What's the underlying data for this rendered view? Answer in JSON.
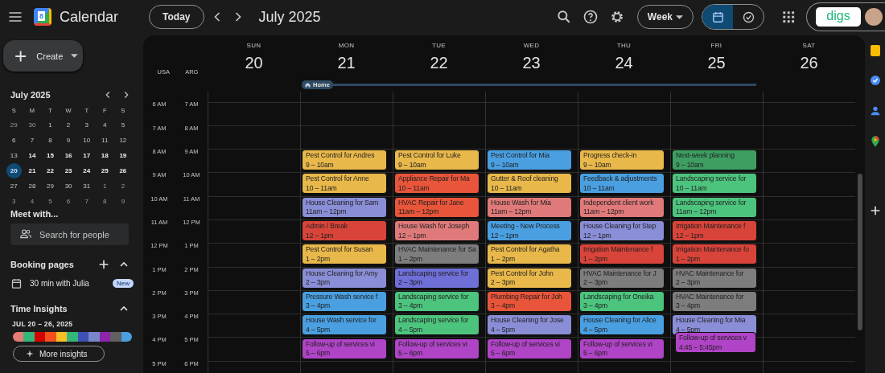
{
  "app": {
    "title": "Calendar",
    "logo_day": "8"
  },
  "toolbar": {
    "today": "Today",
    "period": "July 2025",
    "view": "Week",
    "account_logo": "digs",
    "view_toggle": [
      {
        "kind": "calendar",
        "selected": true
      },
      {
        "kind": "tasks",
        "selected": false
      }
    ]
  },
  "sidebar": {
    "create": "Create",
    "mini_calendar": {
      "title": "July 2025",
      "weekdays": [
        "S",
        "M",
        "T",
        "W",
        "T",
        "F",
        "S"
      ],
      "days": [
        {
          "label": "29",
          "muted": true,
          "bold": false,
          "selected": false
        },
        {
          "label": "30",
          "muted": true,
          "bold": false,
          "selected": false
        },
        {
          "label": "1",
          "muted": false,
          "bold": false,
          "selected": false
        },
        {
          "label": "2",
          "muted": false,
          "bold": false,
          "selected": false
        },
        {
          "label": "3",
          "muted": false,
          "bold": false,
          "selected": false
        },
        {
          "label": "4",
          "muted": false,
          "bold": false,
          "selected": false
        },
        {
          "label": "5",
          "muted": false,
          "bold": false,
          "selected": false
        },
        {
          "label": "6",
          "muted": false,
          "bold": false,
          "selected": false
        },
        {
          "label": "7",
          "muted": false,
          "bold": false,
          "selected": false
        },
        {
          "label": "8",
          "muted": false,
          "bold": false,
          "selected": false
        },
        {
          "label": "9",
          "muted": false,
          "bold": false,
          "selected": false
        },
        {
          "label": "10",
          "muted": false,
          "bold": false,
          "selected": false
        },
        {
          "label": "11",
          "muted": false,
          "bold": false,
          "selected": false
        },
        {
          "label": "12",
          "muted": false,
          "bold": false,
          "selected": false
        },
        {
          "label": "13",
          "muted": false,
          "bold": false,
          "selected": false
        },
        {
          "label": "14",
          "muted": false,
          "bold": true,
          "selected": false
        },
        {
          "label": "15",
          "muted": false,
          "bold": true,
          "selected": false
        },
        {
          "label": "16",
          "muted": false,
          "bold": true,
          "selected": false
        },
        {
          "label": "17",
          "muted": false,
          "bold": true,
          "selected": false
        },
        {
          "label": "18",
          "muted": false,
          "bold": true,
          "selected": false
        },
        {
          "label": "19",
          "muted": false,
          "bold": true,
          "selected": false
        },
        {
          "label": "20",
          "muted": false,
          "bold": true,
          "selected": true
        },
        {
          "label": "21",
          "muted": false,
          "bold": true,
          "selected": false
        },
        {
          "label": "22",
          "muted": false,
          "bold": true,
          "selected": false
        },
        {
          "label": "23",
          "muted": false,
          "bold": true,
          "selected": false
        },
        {
          "label": "24",
          "muted": false,
          "bold": true,
          "selected": false
        },
        {
          "label": "25",
          "muted": false,
          "bold": true,
          "selected": false
        },
        {
          "label": "26",
          "muted": false,
          "bold": true,
          "selected": false
        },
        {
          "label": "27",
          "muted": false,
          "bold": false,
          "selected": false
        },
        {
          "label": "28",
          "muted": false,
          "bold": false,
          "selected": false
        },
        {
          "label": "29",
          "muted": false,
          "bold": false,
          "selected": false
        },
        {
          "label": "30",
          "muted": false,
          "bold": false,
          "selected": false
        },
        {
          "label": "31",
          "muted": false,
          "bold": false,
          "selected": false
        },
        {
          "label": "1",
          "muted": true,
          "bold": false,
          "selected": false
        },
        {
          "label": "2",
          "muted": true,
          "bold": false,
          "selected": false
        },
        {
          "label": "3",
          "muted": true,
          "bold": false,
          "selected": false
        },
        {
          "label": "4",
          "muted": true,
          "bold": false,
          "selected": false
        },
        {
          "label": "5",
          "muted": true,
          "bold": false,
          "selected": false
        },
        {
          "label": "6",
          "muted": true,
          "bold": false,
          "selected": false
        },
        {
          "label": "7",
          "muted": true,
          "bold": false,
          "selected": false
        },
        {
          "label": "8",
          "muted": true,
          "bold": false,
          "selected": false
        },
        {
          "label": "9",
          "muted": true,
          "bold": false,
          "selected": false
        }
      ]
    },
    "meet_with": {
      "heading": "Meet with...",
      "placeholder": "Search for people"
    },
    "booking_pages": {
      "heading": "Booking pages",
      "expanded": true,
      "items": [
        {
          "label": "30 min with Julia",
          "badge": "New"
        }
      ]
    },
    "time_insights": {
      "heading": "Time Insights",
      "expanded": true,
      "range": "JUL 20 – 26, 2025",
      "button": "More insights",
      "segments": [
        {
          "color": "#e67c73"
        },
        {
          "color": "#33b679"
        },
        {
          "color": "#d50000"
        },
        {
          "color": "#f4511e"
        },
        {
          "color": "#f6bf26"
        },
        {
          "color": "#33b679"
        },
        {
          "color": "#3f51b5"
        },
        {
          "color": "#7986cb"
        },
        {
          "color": "#8e24aa"
        },
        {
          "color": "#616161"
        },
        {
          "color": "#4a9fe0"
        }
      ]
    }
  },
  "week": {
    "timezones": [
      "USA",
      "ARG"
    ],
    "hours_primary": [
      "6 AM",
      "7 AM",
      "8 AM",
      "9 AM",
      "10 AM",
      "11 AM",
      "12 PM",
      "1 PM",
      "2 PM",
      "3 PM",
      "4 PM",
      "5 PM"
    ],
    "hours_secondary": [
      "7 AM",
      "8 AM",
      "9 AM",
      "10 AM",
      "11 AM",
      "12 PM",
      "1 PM",
      "2 PM",
      "3 PM",
      "4 PM",
      "5 PM",
      "6 PM"
    ],
    "working_location": {
      "label": "Home"
    },
    "days": [
      {
        "name": "SUN",
        "number": "20"
      },
      {
        "name": "MON",
        "number": "21",
        "home": true,
        "events": [
          {
            "title": "Pest Control for Andres",
            "time": "9 – 10am",
            "color": "#e8b84a"
          },
          {
            "title": "Pest Control for Anne",
            "time": "10 – 11am",
            "color": "#e8b84a"
          },
          {
            "title": "House Cleaning for Sam",
            "time": "11am – 12pm",
            "color": "#8a8ed6"
          },
          {
            "title": "Admin / Break",
            "time": "12 – 1pm",
            "color": "#d9443a"
          },
          {
            "title": "Pest Control for Susan",
            "time": "1 – 2pm",
            "color": "#e8b84a"
          },
          {
            "title": "House Cleaning for Amy",
            "time": "2 – 3pm",
            "color": "#8a8ed6"
          },
          {
            "title": "Pressure Wash service f",
            "time": "3 – 4pm",
            "color": "#4a9fe0"
          },
          {
            "title": "House Wash service for",
            "time": "4 – 5pm",
            "color": "#4a9fe0"
          },
          {
            "title": "Follow-up of services vi",
            "time": "5 – 6pm",
            "color": "#b044c6"
          }
        ]
      },
      {
        "name": "TUE",
        "number": "22",
        "home": true,
        "events": [
          {
            "title": "Pest Control for Luke",
            "time": "9 – 10am",
            "color": "#e8b84a"
          },
          {
            "title": "Appliance Repair for Ma",
            "time": "10 – 11am",
            "color": "#e8553a"
          },
          {
            "title": "HVAC Repair for Jane",
            "time": "11am – 12pm",
            "color": "#e8553a"
          },
          {
            "title": "House Wash for Joseph",
            "time": "12 – 1pm",
            "color": "#e07a7a"
          },
          {
            "title": "HVAC Maintenance for Sa",
            "time": "1 – 2pm",
            "color": "#7d7d7d"
          },
          {
            "title": "Landscaping service for",
            "time": "2 – 3pm",
            "color": "#6f6fd8"
          },
          {
            "title": "Landscaping service for",
            "time": "3 – 4pm",
            "color": "#4dc47e"
          },
          {
            "title": "Landscaping service for",
            "time": "4 – 5pm",
            "color": "#4dc47e"
          },
          {
            "title": "Follow-up of services vi",
            "time": "5 – 6pm",
            "color": "#b044c6"
          }
        ]
      },
      {
        "name": "WED",
        "number": "23",
        "home": true,
        "events": [
          {
            "title": "Pest Control for Mia",
            "time": "9 – 10am",
            "color": "#4a9fe0"
          },
          {
            "title": "Gutter & Roof cleaning",
            "time": "10 – 11am",
            "color": "#e8b84a"
          },
          {
            "title": "House Wash for Mia",
            "time": "11am – 12pm",
            "color": "#e07a7a"
          },
          {
            "title": "Meeting - New Process",
            "time": "12 – 1pm",
            "color": "#4a9fe0"
          },
          {
            "title": "Pest Control for Agatha",
            "time": "1 – 2pm",
            "color": "#e8b84a"
          },
          {
            "title": "Pest Control for John",
            "time": "2 – 3pm",
            "color": "#e8b84a"
          },
          {
            "title": "Plumbing Repair for Joh",
            "time": "3 – 4pm",
            "color": "#e8553a"
          },
          {
            "title": "House Cleaning for Jose",
            "time": "4 – 5pm",
            "color": "#8a8ed6"
          },
          {
            "title": "Follow-up of services vi",
            "time": "5 – 6pm",
            "color": "#b044c6"
          }
        ]
      },
      {
        "name": "THU",
        "number": "24",
        "home": true,
        "events": [
          {
            "title": "Progress check-in",
            "time": "9 – 10am",
            "color": "#e8b84a"
          },
          {
            "title": "Feedback & adjustments",
            "time": "10 – 11am",
            "color": "#4a9fe0"
          },
          {
            "title": "Independent client work",
            "time": "11am – 12pm",
            "color": "#e07a7a"
          },
          {
            "title": "House Cleaning for Step",
            "time": "12 – 1pm",
            "color": "#8a8ed6"
          },
          {
            "title": "Irrigation Maintenance f",
            "time": "1 – 2pm",
            "color": "#d9443a"
          },
          {
            "title": "HVAC Maintenance for J",
            "time": "2 – 3pm",
            "color": "#7d7d7d"
          },
          {
            "title": "Landscaping for Oneika",
            "time": "3 – 4pm",
            "color": "#4dc47e"
          },
          {
            "title": "House Cleaning for Alice",
            "time": "4 – 5pm",
            "color": "#4a9fe0"
          },
          {
            "title": "Follow-up of services vi",
            "time": "5 – 6pm",
            "color": "#b044c6"
          }
        ]
      },
      {
        "name": "FRI",
        "number": "25",
        "home": true,
        "events": [
          {
            "title": "Next-week planning",
            "time": "9 – 10am",
            "color": "#3e9e62"
          },
          {
            "title": "Landscaping service for",
            "time": "10 – 11am",
            "color": "#4dc47e"
          },
          {
            "title": "Landscaping service for",
            "time": "11am – 12pm",
            "color": "#4dc47e"
          },
          {
            "title": "Irrigation Maintenance f",
            "time": "12 – 1pm",
            "color": "#d9443a"
          },
          {
            "title": "Irrigation Maintenance fo",
            "time": "1 – 2pm",
            "color": "#d9443a"
          },
          {
            "title": "HVAC Maintenance for",
            "time": "2 – 3pm",
            "color": "#7d7d7d"
          },
          {
            "title": "HVAC Maintenance for",
            "time": "3 – 4pm",
            "color": "#7d7d7d"
          },
          {
            "title": "House Cleaning for Mia",
            "time": "4 – 5pm",
            "color": "#8a8ed6"
          },
          {
            "title": "Follow-up of services v",
            "time": "4:45 – 5:45pm",
            "color": "#b044c6",
            "kind": "overlap"
          }
        ]
      },
      {
        "name": "SAT",
        "number": "26"
      }
    ]
  }
}
